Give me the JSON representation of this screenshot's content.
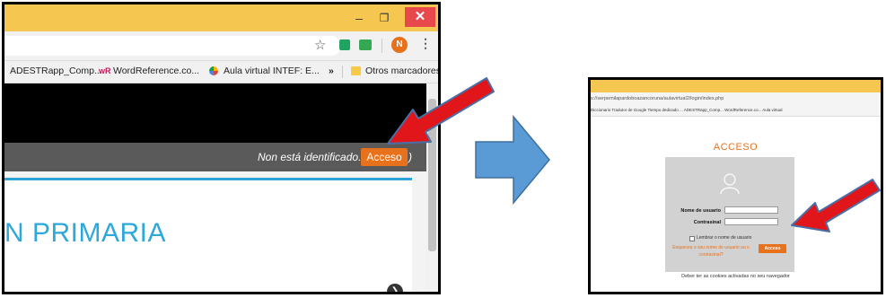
{
  "left_screen": {
    "window_controls": {
      "minimize": "–",
      "maximize": "❐",
      "close": "✕"
    },
    "toolbar_icons": [
      "star-icon",
      "extension-icon",
      "extension-icon",
      "profile-avatar-icon",
      "menu-kebab-icon"
    ],
    "profile_initial": "N",
    "bookmarks": [
      {
        "icon": "page-icon",
        "label": "ADESTRapp_Comp..."
      },
      {
        "icon": "wordreference-icon",
        "icon_text": "wR",
        "label": "WordReference.co..."
      },
      {
        "icon": "intef-icon",
        "label": "Aula virtual INTEF: E..."
      }
    ],
    "bookmarks_overflow": "»",
    "other_bookmarks": "Otros marcadores",
    "not_identified_text": "Non está identificado. (",
    "login_button": "Acceso",
    "close_paren": ")",
    "heading": "N PRIMARIA"
  },
  "right_screen": {
    "url": "s://serpemilapardoboazancoruna/aulavirtual2/login/index.php",
    "bookmarks": "Diccionario   Tradutor de Google   Tiempo dedicado ...   ADESTRapp_Comp...   WordReference.co...   Aula virtual",
    "title": "ACCESO",
    "username_label": "Nome de usuario",
    "password_label": "Contrasinal",
    "remember_label": "Lembrar o nome de usuario",
    "forgot_text": "Esqueceu o seu nome de usuario ou o contrasinal?",
    "login_button": "Acceso",
    "cookies_note": "Deber ter as cookies activadas no seu navegador"
  },
  "colors": {
    "title_bar": "#f5c751",
    "accent_orange": "#e8711c",
    "arrow_red": "#e0161b",
    "arrow_blue": "#5b9bd5",
    "heading_blue": "#2ea8dc"
  }
}
